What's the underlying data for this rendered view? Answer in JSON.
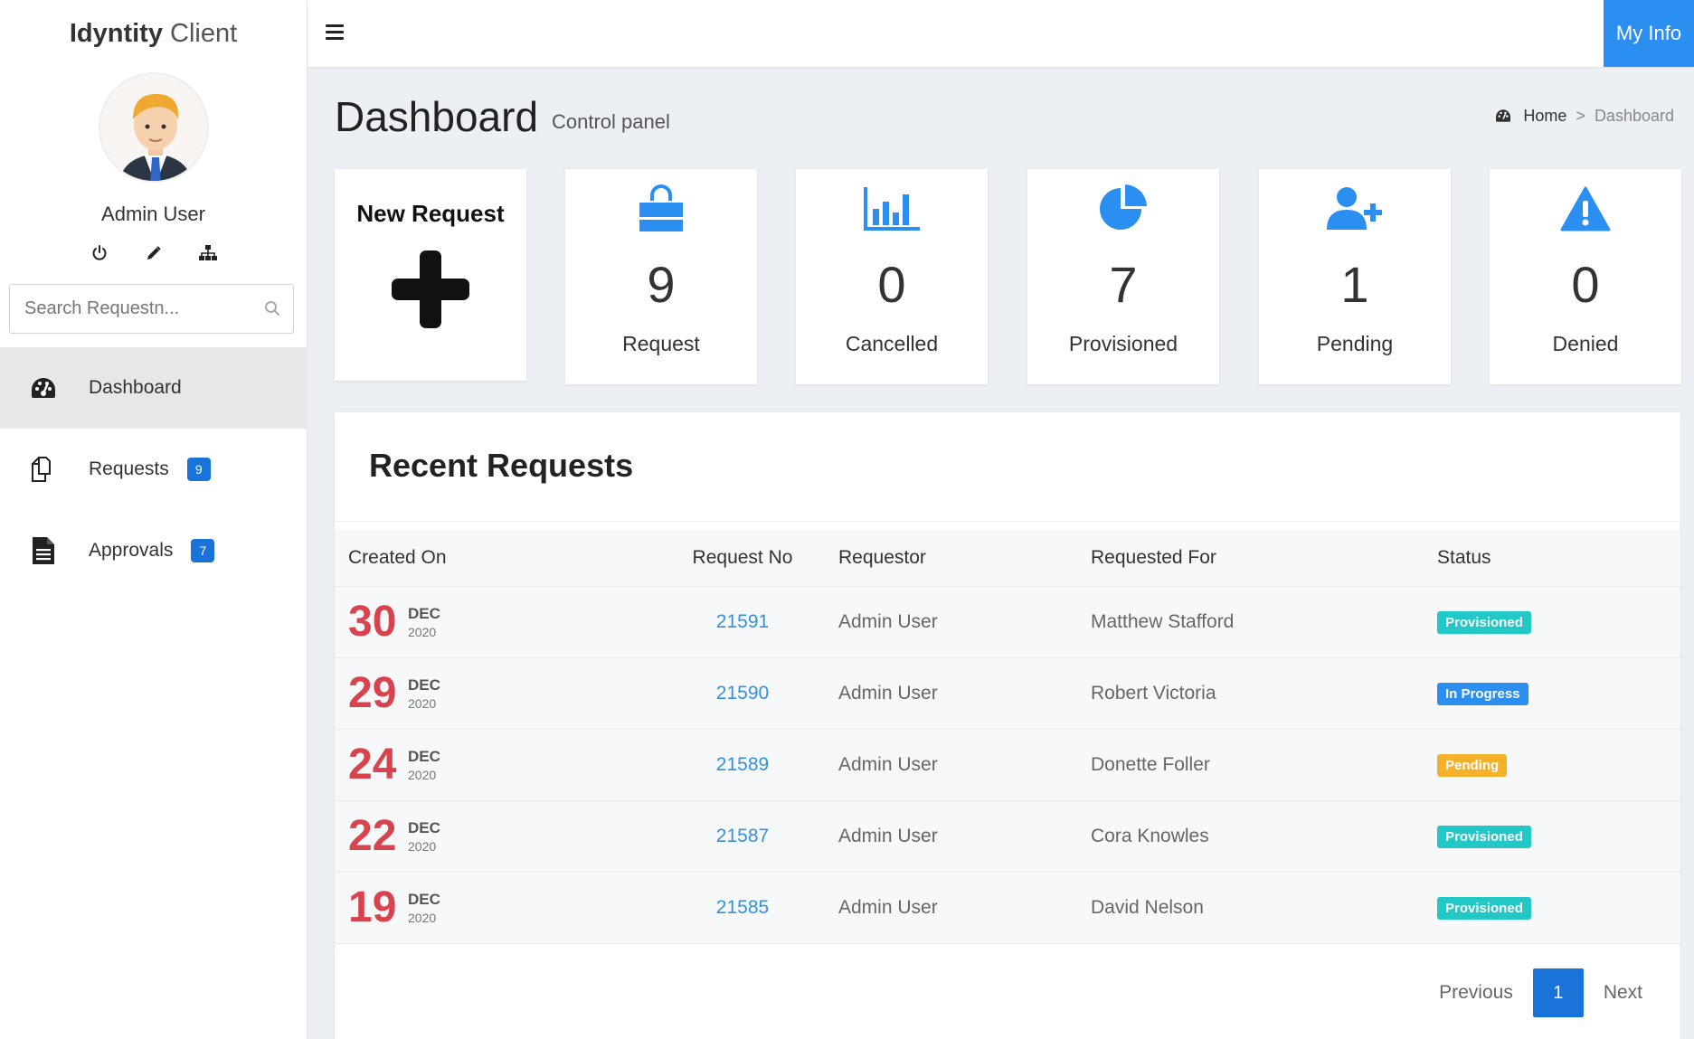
{
  "brand": {
    "bold": "Idyntity",
    "light": "Client"
  },
  "user": {
    "name": "Admin User"
  },
  "search": {
    "placeholder": "Search Requestn..."
  },
  "nav": [
    {
      "label": "Dashboard",
      "icon": "dashboard-gauge-icon",
      "badge": ""
    },
    {
      "label": "Requests",
      "icon": "copy-icon",
      "badge": "9"
    },
    {
      "label": "Approvals",
      "icon": "document-icon",
      "badge": "7"
    }
  ],
  "topbar": {
    "my_info": "My Info"
  },
  "header": {
    "title": "Dashboard",
    "subtitle": "Control panel"
  },
  "breadcrumb": {
    "home": "Home",
    "separator": ">",
    "current": "Dashboard"
  },
  "new_request": {
    "title": "New Request"
  },
  "stats": [
    {
      "value": "9",
      "label": "Request",
      "icon": "shopping-bag-icon"
    },
    {
      "value": "0",
      "label": "Cancelled",
      "icon": "bar-chart-icon"
    },
    {
      "value": "7",
      "label": "Provisioned",
      "icon": "pie-chart-icon"
    },
    {
      "value": "1",
      "label": "Pending",
      "icon": "user-plus-icon"
    },
    {
      "value": "0",
      "label": "Denied",
      "icon": "warning-icon"
    }
  ],
  "recent": {
    "title": "Recent Requests",
    "columns": [
      "Created On",
      "Request No",
      "Requestor",
      "Requested For",
      "Status"
    ],
    "rows": [
      {
        "day": "30",
        "month": "DEC",
        "year": "2020",
        "request_no": "21591",
        "requestor": "Admin User",
        "requested_for": "Matthew Stafford",
        "status": "Provisioned",
        "status_color": "#22c8c5"
      },
      {
        "day": "29",
        "month": "DEC",
        "year": "2020",
        "request_no": "21590",
        "requestor": "Admin User",
        "requested_for": "Robert Victoria",
        "status": "In Progress",
        "status_color": "#2a8ff0"
      },
      {
        "day": "24",
        "month": "DEC",
        "year": "2020",
        "request_no": "21589",
        "requestor": "Admin User",
        "requested_for": "Donette Foller",
        "status": "Pending",
        "status_color": "#f6b12b"
      },
      {
        "day": "22",
        "month": "DEC",
        "year": "2020",
        "request_no": "21587",
        "requestor": "Admin User",
        "requested_for": "Cora Knowles",
        "status": "Provisioned",
        "status_color": "#22c8c5"
      },
      {
        "day": "19",
        "month": "DEC",
        "year": "2020",
        "request_no": "21585",
        "requestor": "Admin User",
        "requested_for": "David Nelson",
        "status": "Provisioned",
        "status_color": "#22c8c5"
      }
    ]
  },
  "pagination": {
    "previous": "Previous",
    "current": "1",
    "next": "Next"
  },
  "colors": {
    "accent": "#2a8ff0",
    "badge": "#1a73d9",
    "date": "#d9434d"
  }
}
